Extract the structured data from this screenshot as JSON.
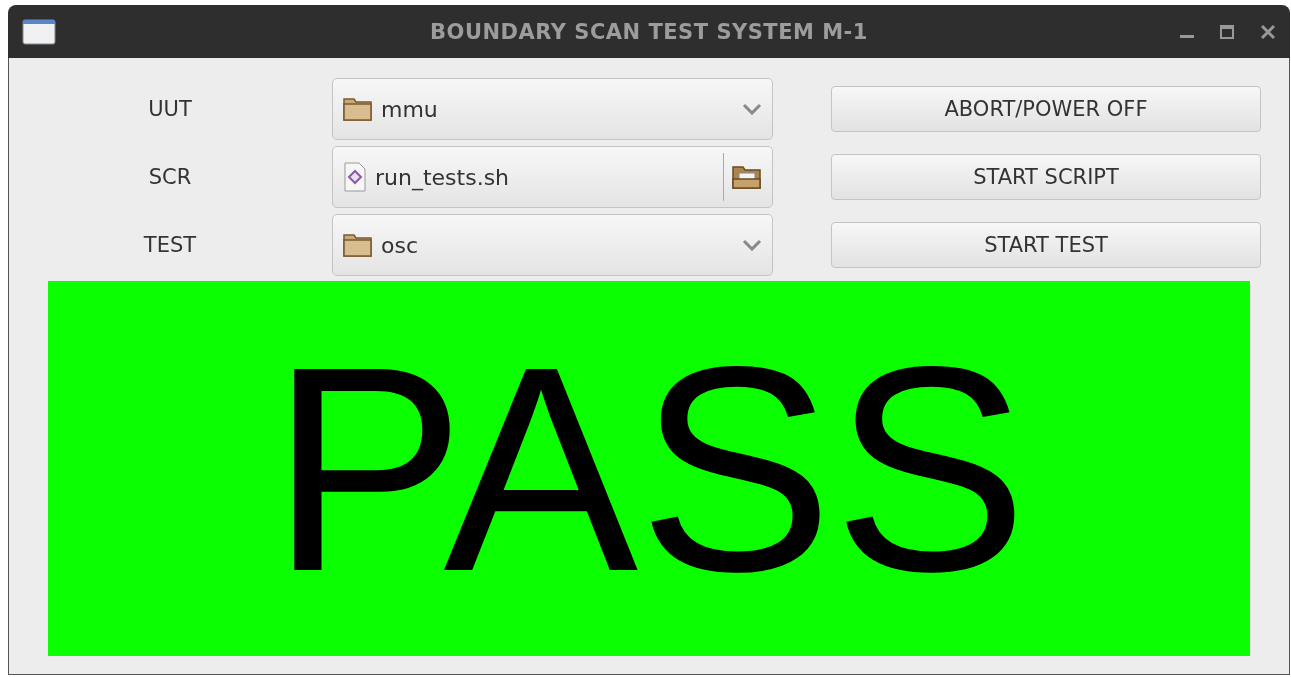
{
  "window": {
    "title": "BOUNDARY SCAN TEST SYSTEM M-1"
  },
  "rows": [
    {
      "label": "UUT",
      "kind": "combo",
      "value": "mmu",
      "button": "ABORT/POWER OFF"
    },
    {
      "label": "SCR",
      "kind": "file",
      "value": "run_tests.sh",
      "button": "START SCRIPT"
    },
    {
      "label": "TEST",
      "kind": "combo",
      "value": "osc",
      "button": "START TEST"
    }
  ],
  "result": {
    "text": "PASS",
    "passed": true
  }
}
